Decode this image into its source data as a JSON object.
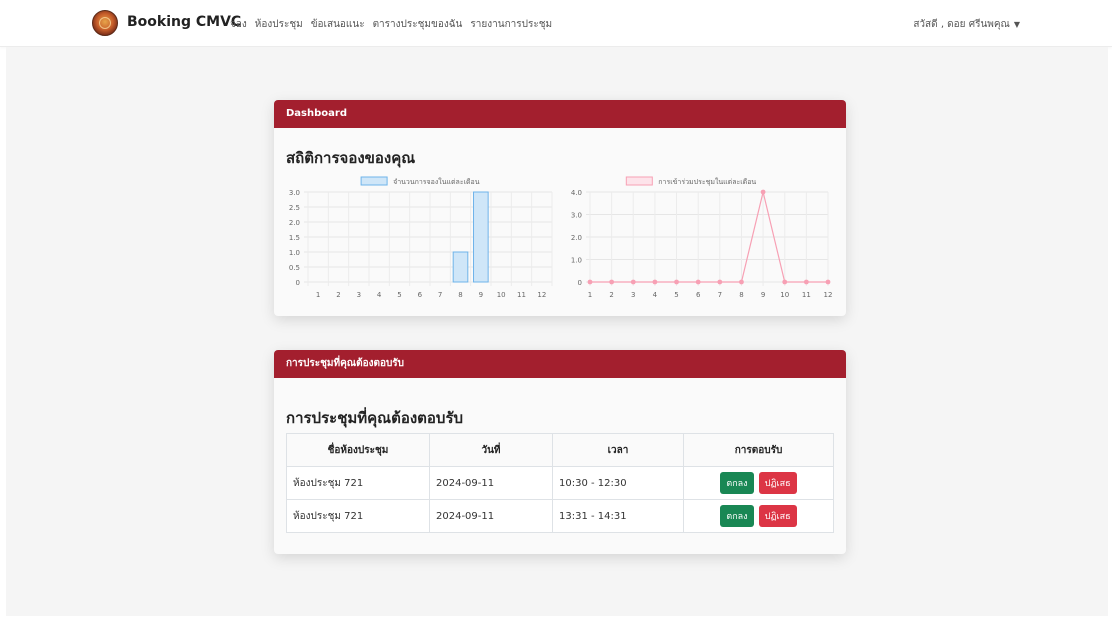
{
  "nav": {
    "brand": "Booking CMVC",
    "links": [
      "จอง",
      "ห้องประชุม",
      "ข้อเสนอแนะ",
      "ตารางประชุมของฉัน",
      "รายงานการประชุม"
    ],
    "user": "สวัสดี , ดอย ศรีนพคุณ"
  },
  "dashboard": {
    "header": "Dashboard",
    "title": "สถิติการจองของคุณ"
  },
  "colors": {
    "brand_red": "#a31f2e",
    "bar_fill": "#cfe6f8",
    "bar_stroke": "#6fb4ea",
    "line": "#f7a0b4",
    "ok_green": "#198754",
    "reject_red": "#dc3545"
  },
  "chart_data": [
    {
      "type": "bar",
      "title": "",
      "legend": "จำนวนการจองในแต่ละเดือน",
      "legend_position": "top",
      "grid": true,
      "categories": [
        "1",
        "2",
        "3",
        "4",
        "5",
        "6",
        "7",
        "8",
        "9",
        "10",
        "11",
        "12"
      ],
      "values": [
        0,
        0,
        0,
        0,
        0,
        0,
        0,
        1,
        3,
        0,
        0,
        0
      ],
      "ylim": [
        0,
        3
      ],
      "yticks": [
        0,
        0.5,
        1.0,
        1.5,
        2.0,
        2.5,
        3.0
      ],
      "ytick_labels": [
        "0",
        "0.5",
        "1.0",
        "1.5",
        "2.0",
        "2.5",
        "3.0"
      ]
    },
    {
      "type": "line",
      "title": "",
      "legend": "การเข้าร่วมประชุมในแต่ละเดือน",
      "legend_position": "top",
      "grid": true,
      "categories": [
        "1",
        "2",
        "3",
        "4",
        "5",
        "6",
        "7",
        "8",
        "9",
        "10",
        "11",
        "12"
      ],
      "values": [
        0,
        0,
        0,
        0,
        0,
        0,
        0,
        0,
        4,
        0,
        0,
        0
      ],
      "ylim": [
        0,
        4
      ],
      "yticks": [
        0,
        1,
        2,
        3,
        4
      ],
      "ytick_labels": [
        "0",
        "1.0",
        "2.0",
        "3.0",
        "4.0"
      ]
    }
  ],
  "responses": {
    "header": "การประชุมที่คุณต้องตอบรับ",
    "title": "การประชุมที่คุณต้องตอบรับ",
    "columns": [
      "ชื่อห้องประชุม",
      "วันที่",
      "เวลา",
      "การตอบรับ"
    ],
    "accept_label": "ตกลง",
    "reject_label": "ปฏิเสธ",
    "rows": [
      {
        "room": "ห้องประชุม 721",
        "date": "2024-09-11",
        "time": "10:30 - 12:30"
      },
      {
        "room": "ห้องประชุม 721",
        "date": "2024-09-11",
        "time": "13:31 - 14:31"
      }
    ]
  }
}
